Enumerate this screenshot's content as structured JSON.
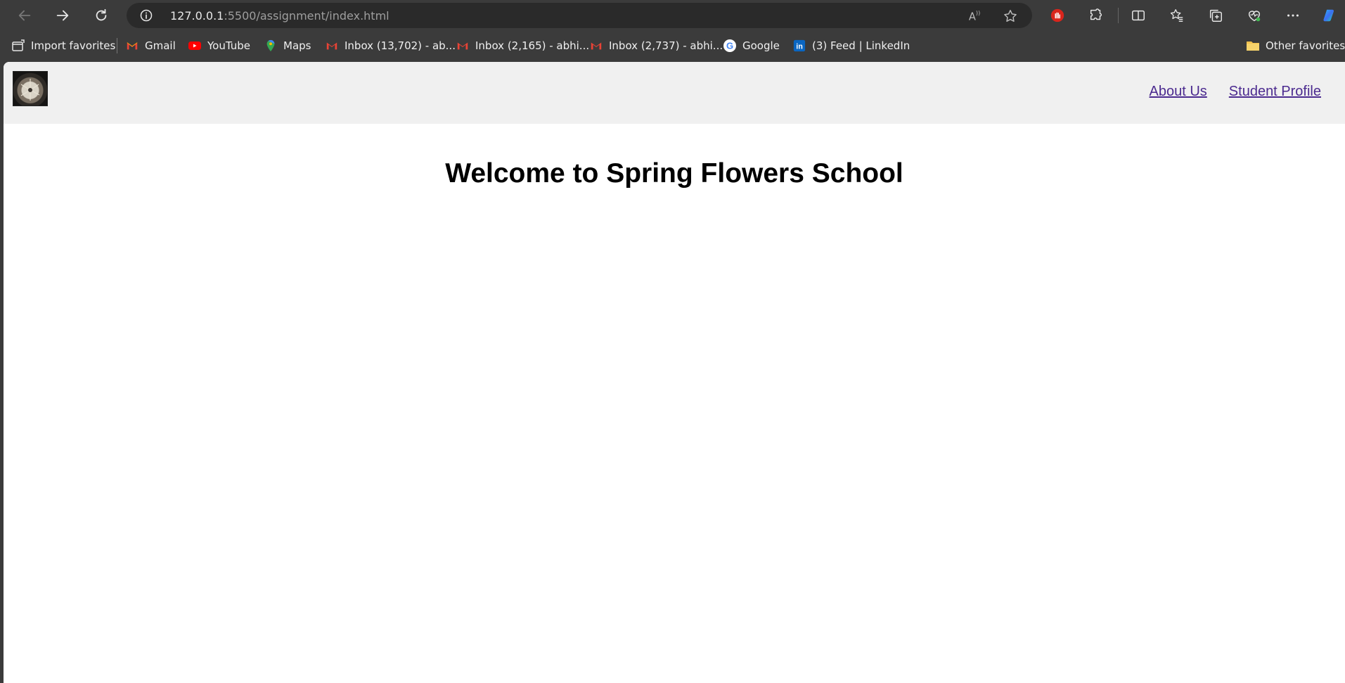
{
  "browser": {
    "url_host": "127.0.0.1",
    "url_path": ":5500/assignment/index.html",
    "icons": [
      "back-icon",
      "forward-icon",
      "refresh-icon",
      "info-icon",
      "read-aloud-icon",
      "favorite-star-icon",
      "adblock-icon",
      "extensions-icon",
      "split-screen-icon",
      "favorites-icon",
      "collections-icon",
      "browser-essentials-icon",
      "more-icon",
      "copilot-icon"
    ]
  },
  "favorites": {
    "items": [
      {
        "label": "Import favorites",
        "icon": "import-icon"
      },
      {
        "label": "Gmail",
        "icon": "gmail-icon"
      },
      {
        "label": "YouTube",
        "icon": "youtube-icon"
      },
      {
        "label": "Maps",
        "icon": "maps-icon"
      },
      {
        "label": "Inbox (13,702) - ab...",
        "icon": "gmail-icon"
      },
      {
        "label": "Inbox (2,165) - abhi...",
        "icon": "gmail-icon"
      },
      {
        "label": "Inbox (2,737) - abhi...",
        "icon": "gmail-icon"
      },
      {
        "label": "Google",
        "icon": "google-icon"
      },
      {
        "label": "(3) Feed | LinkedIn",
        "icon": "linkedin-icon"
      }
    ],
    "other": "Other favorites"
  },
  "page": {
    "nav": [
      "About Us",
      "Student Profile"
    ],
    "title": "Welcome to Spring Flowers School",
    "link_color": "#4b2a8f",
    "header_bg": "#f0f0f0"
  }
}
